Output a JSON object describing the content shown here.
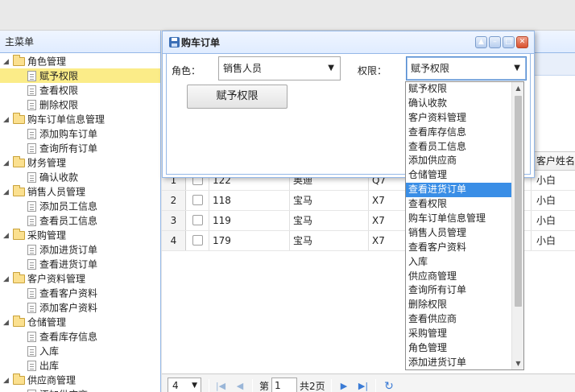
{
  "menu": {
    "title": "主菜单",
    "groups": [
      {
        "label": "角色管理",
        "items": [
          "赋予权限",
          "查看权限",
          "删除权限"
        ]
      },
      {
        "label": "购车订单信息管理",
        "items": [
          "添加购车订单",
          "查询所有订单"
        ]
      },
      {
        "label": "财务管理",
        "items": [
          "确认收款"
        ]
      },
      {
        "label": "销售人员管理",
        "items": [
          "添加员工信息",
          "查看员工信息"
        ]
      },
      {
        "label": "采购管理",
        "items": [
          "添加进货订单",
          "查看进货订单"
        ]
      },
      {
        "label": "客户资料管理",
        "items": [
          "查看客户资料",
          "添加客户资料"
        ]
      },
      {
        "label": "仓储管理",
        "items": [
          "查看库存信息",
          "入库",
          "出库"
        ]
      },
      {
        "label": "供应商管理",
        "items": [
          "添加供应商"
        ]
      }
    ]
  },
  "grid": {
    "header_customer": "客户姓名",
    "rows": [
      {
        "rn": "1",
        "id": "122",
        "brand": "奥迪",
        "model": "Q7",
        "customer": "小白"
      },
      {
        "rn": "2",
        "id": "118",
        "brand": "宝马",
        "model": "X7",
        "customer": "小白"
      },
      {
        "rn": "3",
        "id": "119",
        "brand": "宝马",
        "model": "X7",
        "customer": "小白"
      },
      {
        "rn": "4",
        "id": "179",
        "brand": "宝马",
        "model": "X7",
        "customer": "小白"
      }
    ]
  },
  "pager": {
    "page_size": "4",
    "page_prefix": "第",
    "page_value": "1",
    "page_total": "共2页"
  },
  "dialog": {
    "title": "购车订单",
    "role_label": "角色：",
    "role_value": "销售人员",
    "perm_label": "权限：",
    "perm_value": "赋予权限",
    "grant_button": "赋予权限"
  },
  "dropdown": {
    "options": [
      "赋予权限",
      "确认收款",
      "客户资料管理",
      "查看库存信息",
      "查看员工信息",
      "添加供应商",
      "仓储管理",
      "查看进货订单",
      "查看权限",
      "购车订单信息管理",
      "销售人员管理",
      "查看客户资料",
      "入库",
      "供应商管理",
      "查询所有订单",
      "删除权限",
      "查看供应商",
      "采购管理",
      "角色管理",
      "添加进货订单"
    ],
    "highlighted": "查看进货订单"
  },
  "colors": {
    "accent": "#3a8ee6",
    "selected_tree": "#fbec88",
    "border": "#95b8e7"
  }
}
